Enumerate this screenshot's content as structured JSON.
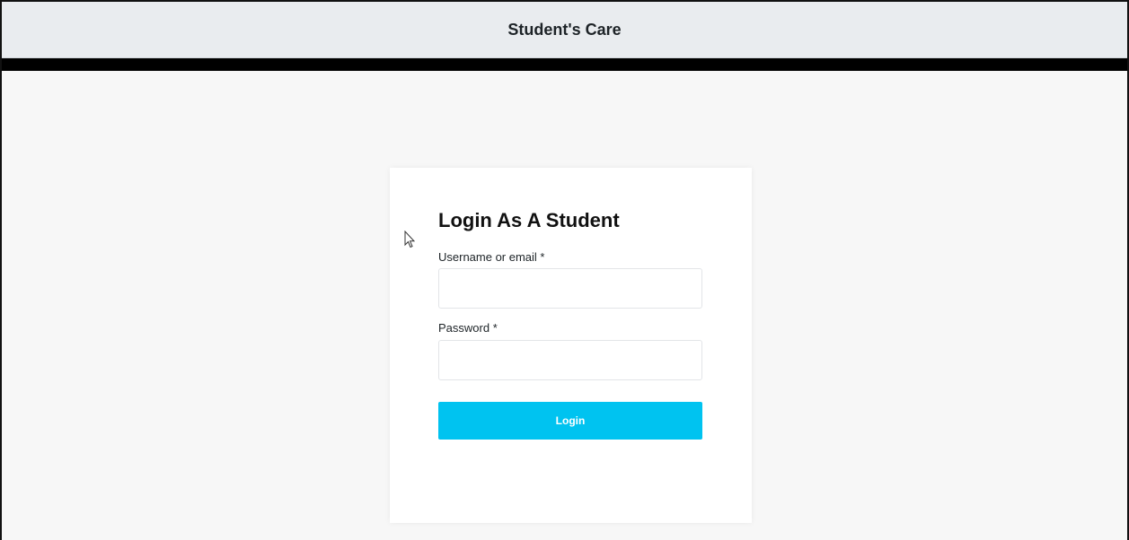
{
  "header": {
    "title": "Student's Care"
  },
  "login": {
    "heading": "Login As A Student",
    "username_label": "Username or email *",
    "username_value": "",
    "password_label": "Password *",
    "password_value": "",
    "button_label": "Login"
  },
  "colors": {
    "header_bg": "#e9ecef",
    "accent_button": "#00c3f0",
    "page_bg": "#f7f7f7"
  },
  "icons": {
    "cursor": "mouse-pointer-icon"
  }
}
